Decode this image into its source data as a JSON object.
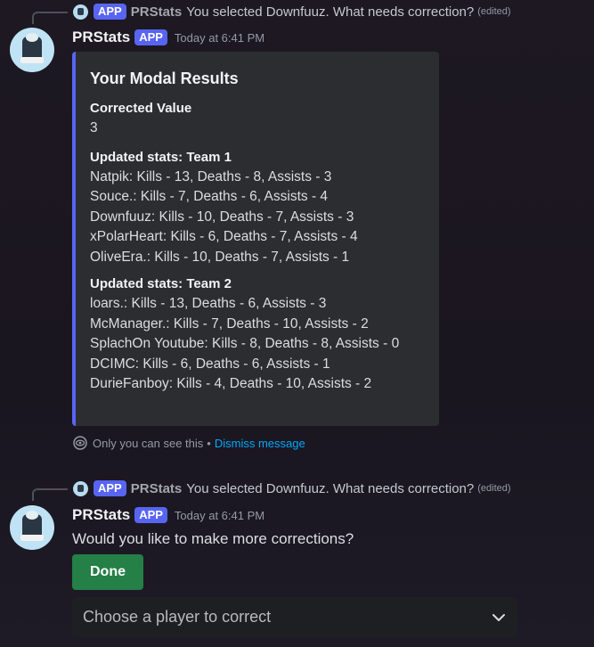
{
  "messages": [
    {
      "reply": {
        "badge": "APP",
        "name": "PRStats",
        "text": "You selected Downfuuz. What needs correction?",
        "edited": "(edited)"
      },
      "author": "PRStats",
      "badge": "APP",
      "timestamp": "Today at 6:41 PM",
      "embed": {
        "title": "Your Modal Results",
        "fields": [
          {
            "name": "Corrected Value",
            "lines": [
              "3"
            ]
          },
          {
            "name": "Updated stats: Team 1",
            "lines": [
              "Natpik: Kills - 13, Deaths - 8, Assists - 3",
              "Souce.: Kills - 7, Deaths - 6, Assists - 4",
              "Downfuuz: Kills - 10, Deaths - 7, Assists - 3",
              "xPolarHeart: Kills - 6, Deaths - 7, Assists - 4",
              "OliveEra.: Kills - 10, Deaths - 7, Assists - 1"
            ]
          },
          {
            "name": "Updated stats: Team 2",
            "lines": [
              "loars.: Kills - 13, Deaths - 6, Assists - 3",
              "McManager.: Kills - 7, Deaths - 10, Assists - 2",
              "SplachOn Youtube: Kills - 8, Deaths - 8, Assists - 0",
              "DCIMC: Kills - 6, Deaths - 6, Assists - 1",
              "DurieFanboy: Kills - 4, Deaths - 10, Assists - 2"
            ]
          }
        ]
      },
      "ephemeral": {
        "note": "Only you can see this",
        "separator": "•",
        "dismiss": "Dismiss message"
      }
    },
    {
      "reply": {
        "badge": "APP",
        "name": "PRStats",
        "text": "You selected Downfuuz. What needs correction?",
        "edited": "(edited)"
      },
      "author": "PRStats",
      "badge": "APP",
      "timestamp": "Today at 6:41 PM",
      "content": "Would you like to make more corrections?",
      "button": "Done",
      "select_placeholder": "Choose a player to correct"
    }
  ],
  "colors": {
    "blurple": "#5865f2",
    "success": "#248046",
    "link": "#00a8fc"
  }
}
